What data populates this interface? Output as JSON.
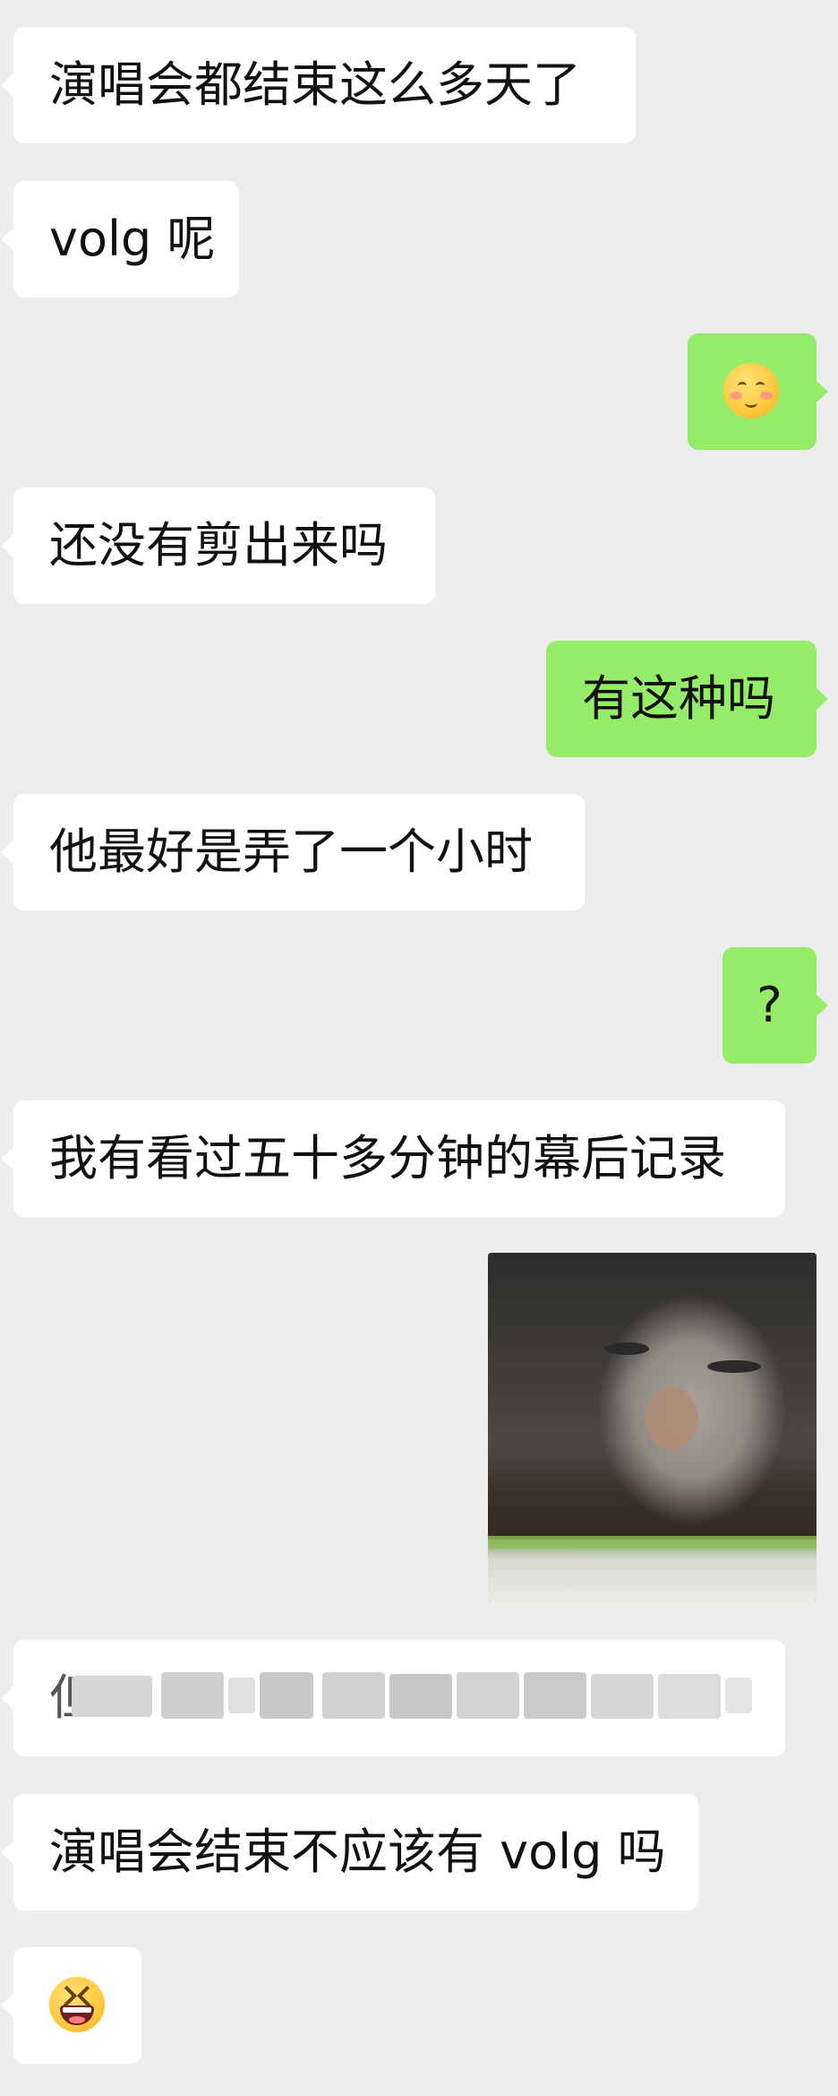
{
  "chat": {
    "messages": [
      {
        "side": "in",
        "text": "演唱会都结束这么多天了"
      },
      {
        "side": "in",
        "text": "volg 呢"
      },
      {
        "side": "out",
        "type": "emoji",
        "emoji": "blushing-face-emoji"
      },
      {
        "side": "in",
        "text": "还没有剪出来吗"
      },
      {
        "side": "out",
        "text": "有这种吗"
      },
      {
        "side": "in",
        "text": "他最好是弄了一个小时"
      },
      {
        "side": "out",
        "text": "?"
      },
      {
        "side": "in",
        "text": "我有看过五十多分钟的幕后记录"
      },
      {
        "side": "out",
        "type": "image",
        "image": "cat-photo"
      },
      {
        "side": "in",
        "type": "redacted",
        "visible_text": "但"
      },
      {
        "side": "in",
        "text": "演唱会结束不应该有 volg 吗"
      },
      {
        "side": "in",
        "type": "emoji",
        "emoji": "laughing-squinting-face-emoji"
      }
    ]
  },
  "colors": {
    "background": "#ededed",
    "incoming_bubble": "#ffffff",
    "outgoing_bubble": "#95ec69"
  }
}
